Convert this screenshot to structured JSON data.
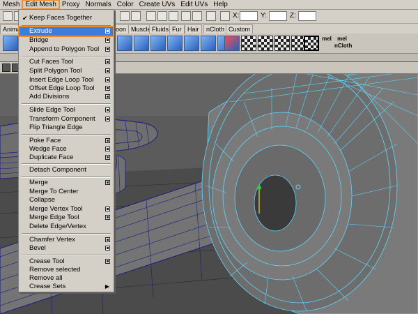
{
  "menubar": {
    "items": [
      "Mesh",
      "Edit Mesh",
      "Proxy",
      "Normals",
      "Color",
      "Create UVs",
      "Edit UVs",
      "Help"
    ],
    "active_index": 1
  },
  "toolbar": {
    "x_label": "X:",
    "y_label": "Y:",
    "z_label": "Z:"
  },
  "shelf_tabs": [
    "Animation",
    "oon",
    "Muscle",
    "Fluids",
    "Fur",
    "Hair",
    "nCloth",
    "Custom"
  ],
  "shelf": {
    "mel_label_1": "mel",
    "mel_label_2": "mel",
    "mel_label_2b": "nCloth"
  },
  "edit_mesh_menu": {
    "items": [
      {
        "label": "Keep Faces Together",
        "checked": true,
        "option_box": false
      },
      {
        "label": "Extrude",
        "highlighted": true,
        "option_box": true
      },
      {
        "label": "Bridge",
        "option_box": true
      },
      {
        "label": "Append to Polygon Tool",
        "option_box": true
      },
      {
        "label": "Cut Faces Tool",
        "option_box": true
      },
      {
        "label": "Split Polygon Tool",
        "option_box": true
      },
      {
        "label": "Insert Edge Loop Tool",
        "option_box": true
      },
      {
        "label": "Offset Edge Loop Tool",
        "option_box": true
      },
      {
        "label": "Add Divisions",
        "option_box": true
      },
      {
        "label": "Slide Edge Tool",
        "option_box": true
      },
      {
        "label": "Transform Component",
        "option_box": true
      },
      {
        "label": "Flip Triangle Edge",
        "option_box": false
      },
      {
        "label": "Poke Face",
        "option_box": true
      },
      {
        "label": "Wedge Face",
        "option_box": true
      },
      {
        "label": "Duplicate Face",
        "option_box": true
      },
      {
        "label": "Detach Component",
        "option_box": false
      },
      {
        "label": "Merge",
        "option_box": true
      },
      {
        "label": "Merge To Center",
        "option_box": false
      },
      {
        "label": "Collapse",
        "option_box": false
      },
      {
        "label": "Merge Vertex Tool",
        "option_box": true
      },
      {
        "label": "Merge Edge Tool",
        "option_box": true
      },
      {
        "label": "Delete Edge/Vertex",
        "option_box": false
      },
      {
        "label": "Chamfer Vertex",
        "option_box": true
      },
      {
        "label": "Bevel",
        "option_box": true
      },
      {
        "label": "Crease Tool",
        "option_box": true
      },
      {
        "label": "Remove selected",
        "option_box": false
      },
      {
        "label": "Remove all",
        "option_box": false
      },
      {
        "label": "Crease Sets",
        "submenu": true
      }
    ]
  },
  "colors": {
    "accent_highlight": "#f08a24",
    "menu_selection": "#3a7ddb",
    "wireframe_cyan": "#5fd8ff",
    "wireframe_blue": "#2a2aa0"
  }
}
